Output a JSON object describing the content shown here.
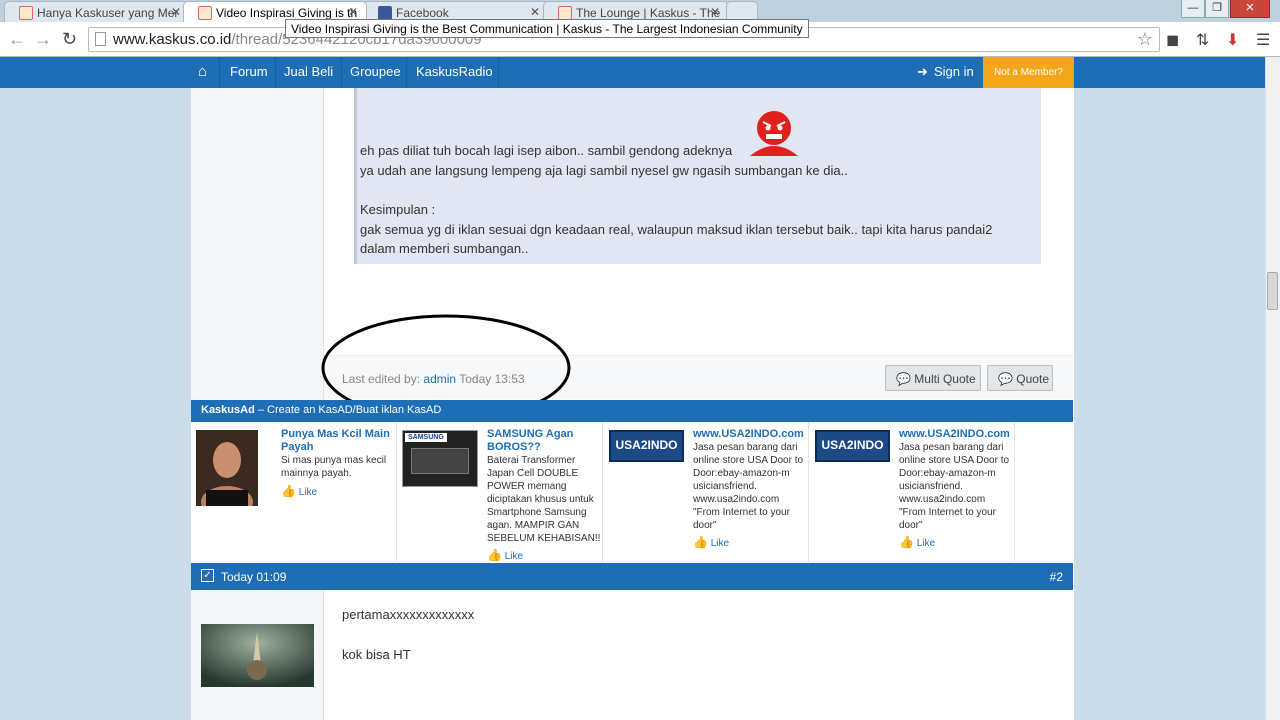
{
  "browser": {
    "tabs": [
      {
        "title": "Hanya Kaskuser yang Mer"
      },
      {
        "title": "Video Inspirasi Giving is th"
      },
      {
        "title": "Facebook"
      },
      {
        "title": "The Lounge | Kaskus - The"
      }
    ],
    "tooltip": "Video Inspirasi Giving is the Best Communication | Kaskus - The Largest Indonesian Community",
    "url_host": "www.kaskus.co.id",
    "url_path": "/thread/5236442120cb17da39000009"
  },
  "nav": {
    "items": [
      "Forum",
      "Jual Beli",
      "Groupee",
      "KaskusRadio"
    ],
    "signin": "Sign in",
    "not_member": "Not a Member?"
  },
  "post1": {
    "line1": "eh pas diliat tuh bocah lagi isep aibon.. sambil gendong adeknya",
    "line2": "ya udah ane langsung lempeng aja lagi sambil nyesel gw ngasih sumbangan ke dia..",
    "line3": "Kesimpulan :",
    "line4": "gak semua yg di iklan sesuai dgn keadaan real, walaupun maksud iklan tersebut baik.. tapi kita harus pandai2",
    "line5": "dalam memberi sumbangan..",
    "edited_label": "Last edited by:",
    "edited_user": "admin",
    "edited_time": "Today 13:53",
    "multi_quote": "Multi Quote",
    "quote": "Quote"
  },
  "kaskusad": {
    "brand": "KaskusAd",
    "tagline": "– Create an KasAD/Buat iklan KasAD",
    "ads": [
      {
        "title": "Punya Mas Kcil Main Payah",
        "body": "Si mas punya mas kecil mainnya payah.",
        "like": "Like"
      },
      {
        "title": "SAMSUNG Agan BOROS??",
        "body": "Baterai Transformer Japan Cell DOUBLE POWER memang diciptakan khusus untuk Smartphone Samsung agan. MAMPIR GAN SEBELUM KEHABISAN!!",
        "like": "Like",
        "img_text": "SAMSUNG"
      },
      {
        "title": "www.USA2INDO.com",
        "body": "Jasa pesan barang dari online store USA Door to Door:ebay-amazon-m usiciansfriend. www.usa2indo.com \"From Internet to your door\"",
        "like": "Like",
        "img_text": "USA2INDO"
      },
      {
        "title": "www.USA2INDO.com",
        "body": "Jasa pesan barang dari online store USA Door to Door:ebay-amazon-m usiciansfriend. www.usa2indo.com \"From Internet to your door\"",
        "like": "Like",
        "img_text": "USA2INDO"
      }
    ]
  },
  "post2": {
    "time": "Today 01:09",
    "number": "#2",
    "line1": "pertamaxxxxxxxxxxxxx",
    "line2": "kok bisa HT"
  },
  "colors": {
    "brand_blue": "#1e6eb5",
    "member_orange": "#f4a61b"
  }
}
